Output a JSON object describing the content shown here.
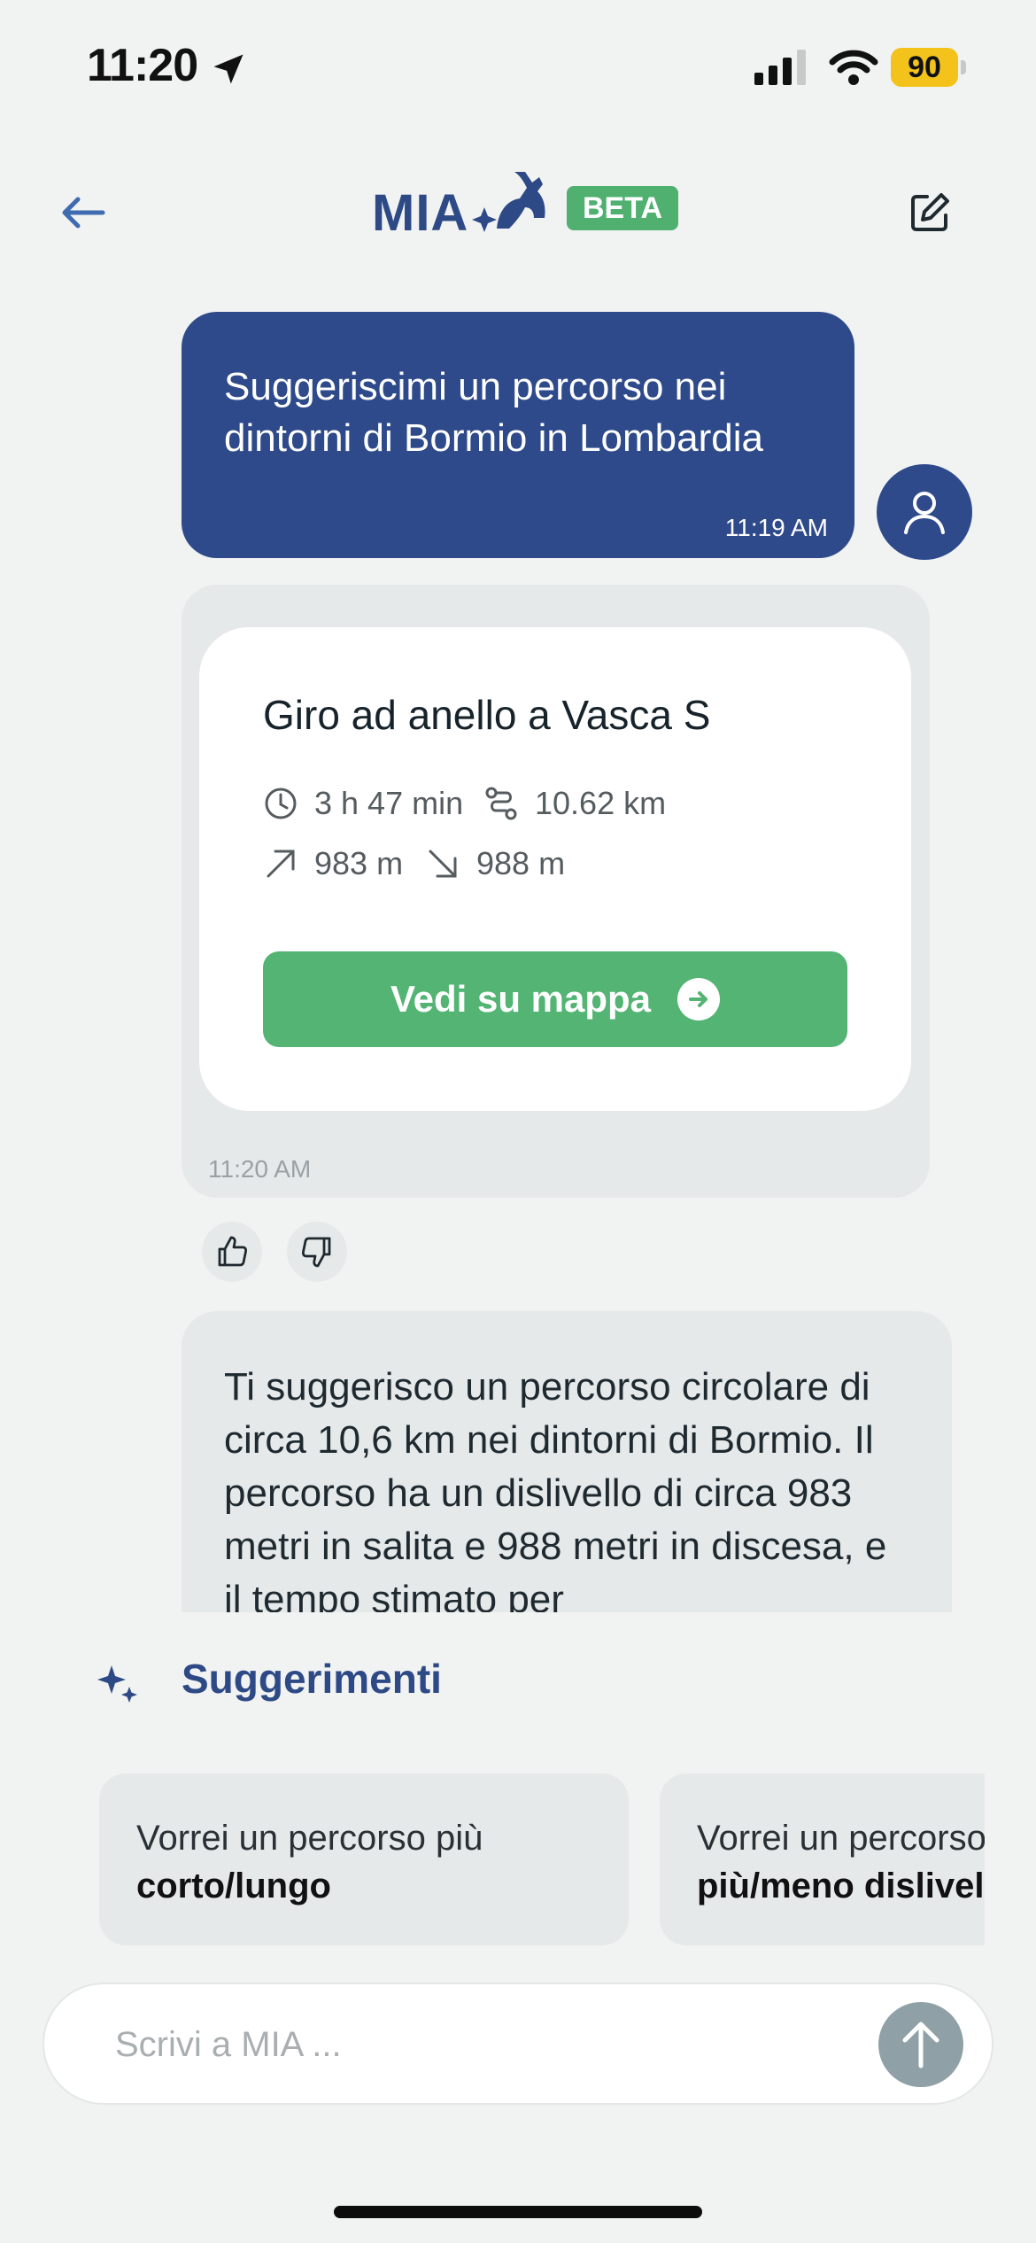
{
  "status_bar": {
    "time": "11:20",
    "battery": "90"
  },
  "header": {
    "logo_text": "MIA",
    "badge": "BETA"
  },
  "user_message": {
    "text": "Suggeriscimi un percorso nei dintorni di Bormio in Lombardia",
    "time": "11:19 AM"
  },
  "route_card": {
    "title": "Giro ad anello a Vasca S",
    "duration": "3 h 47 min",
    "distance": "10.62 km",
    "ascent": "983 m",
    "descent": "988 m",
    "button_label": "Vedi su mappa",
    "time": "11:20 AM"
  },
  "reply": {
    "text": "Ti suggerisco un percorso circolare di circa 10,6 km nei dintorni di Bormio. Il percorso ha un dislivello di circa 983 metri in salita e 988 metri in discesa, e il tempo stimato per"
  },
  "suggestions": {
    "title": "Suggerimenti",
    "chips": [
      {
        "line1": "Vorrei un percorso più",
        "line2": "corto/lungo"
      },
      {
        "line1": "Vorrei un percorso",
        "line2": "più/meno dislivello"
      }
    ]
  },
  "composer": {
    "placeholder": "Scrivi a MIA ..."
  },
  "colors": {
    "primary": "#2e4a8a",
    "accent": "#53b473",
    "bubble_bg": "#e6e9ea"
  }
}
